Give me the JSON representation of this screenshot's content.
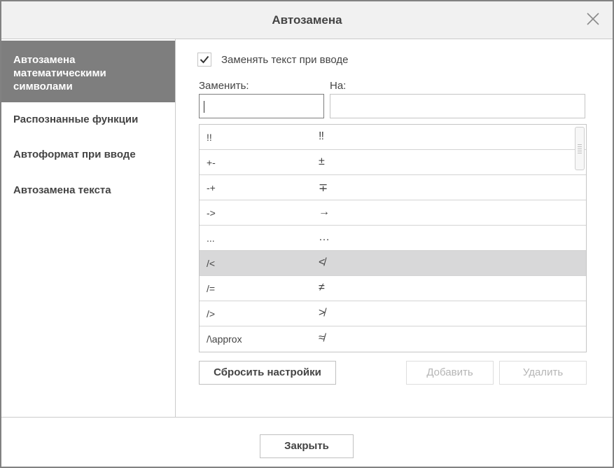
{
  "dialog": {
    "title": "Автозамена",
    "close_button": "Закрыть"
  },
  "sidebar": {
    "items": [
      {
        "label": "Автозамена математическими символами",
        "active": true
      },
      {
        "label": "Распознанные функции",
        "active": false
      },
      {
        "label": "Автоформат при вводе",
        "active": false
      },
      {
        "label": "Автозамена текста",
        "active": false
      }
    ]
  },
  "main": {
    "replace_while_typing": {
      "label": "Заменять текст при вводе",
      "checked": true
    },
    "replace_label": "Заменить:",
    "with_label": "На:",
    "replace_value": "",
    "with_value": "",
    "rows": [
      {
        "from": "!!",
        "to": "‼"
      },
      {
        "from": "+-",
        "to": "±"
      },
      {
        "from": "-+",
        "to": "∓"
      },
      {
        "from": "->",
        "to": "→"
      },
      {
        "from": "...",
        "to": "…"
      },
      {
        "from": "/<",
        "to": "≮"
      },
      {
        "from": "/=",
        "to": "≠"
      },
      {
        "from": "/>",
        "to": "≯"
      },
      {
        "from": "/\\approx",
        "to": "≉"
      }
    ],
    "selected_row": 5,
    "reset_button": "Сбросить настройки",
    "add_button": "Добавить",
    "delete_button": "Удалить"
  }
}
